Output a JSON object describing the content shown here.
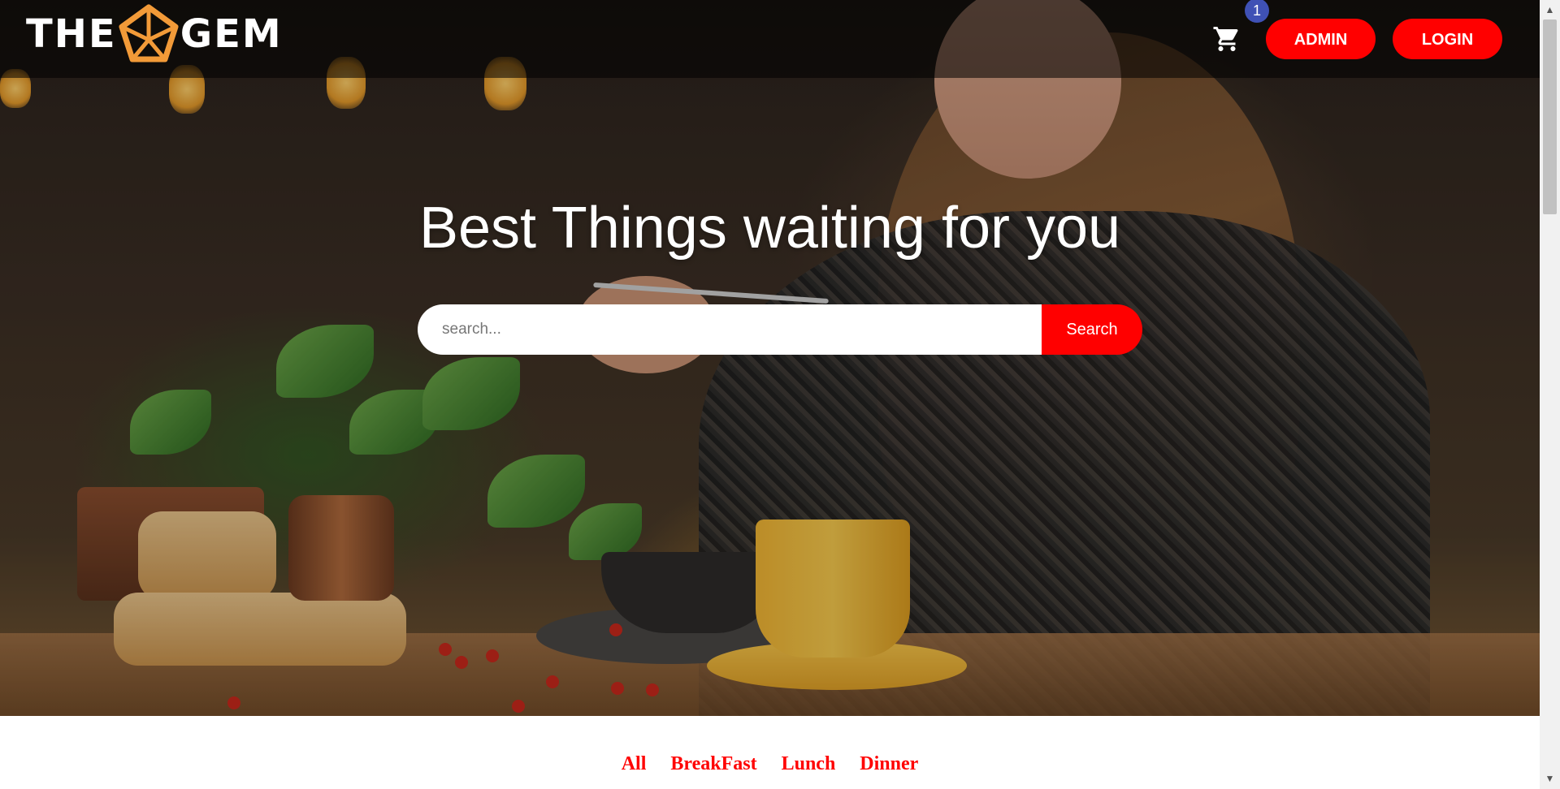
{
  "brand": {
    "name_left": "THE",
    "name_right": "GEM",
    "accent": "#f29a38"
  },
  "nav": {
    "cart_count": "1",
    "admin_label": "ADMIN",
    "login_label": "LOGIN",
    "button_color": "#ff0000",
    "badge_color": "#3f51b5"
  },
  "hero": {
    "title": "Best Things waiting for you",
    "search": {
      "placeholder": "search...",
      "value": "",
      "button_label": "Search"
    }
  },
  "categories": [
    {
      "label": "All"
    },
    {
      "label": "BreakFast"
    },
    {
      "label": "Lunch"
    },
    {
      "label": "Dinner"
    }
  ],
  "icons": {
    "cart": "shopping-cart-icon",
    "logo": "pentagon-gem-icon"
  }
}
